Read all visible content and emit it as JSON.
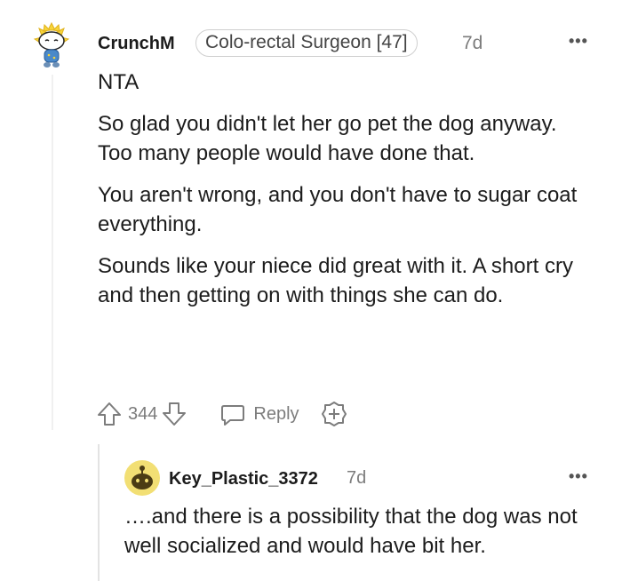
{
  "comment": {
    "author": "CrunchM",
    "flair": "Colo-rectal Surgeon [47]",
    "time": "7d",
    "paragraphs": [
      "NTA",
      "So glad you didn't let her go pet the dog anyway. Too many people would have done that.",
      "You aren't wrong, and you don't have to sugar coat everything.",
      "Sounds like your niece did great with it. A short cry and then getting on with things she can do."
    ],
    "upvotes": "344",
    "reply_label": "Reply"
  },
  "reply": {
    "author": "Key_Plastic_3372",
    "time": "7d",
    "text": "….and there is a possibility that the dog was not well socialized and would have bit her."
  },
  "icons": {
    "more": "more-options-icon",
    "upvote": "upvote-arrow-icon",
    "downvote": "downvote-arrow-icon",
    "reply": "speech-bubble-icon",
    "award": "award-plus-icon"
  }
}
